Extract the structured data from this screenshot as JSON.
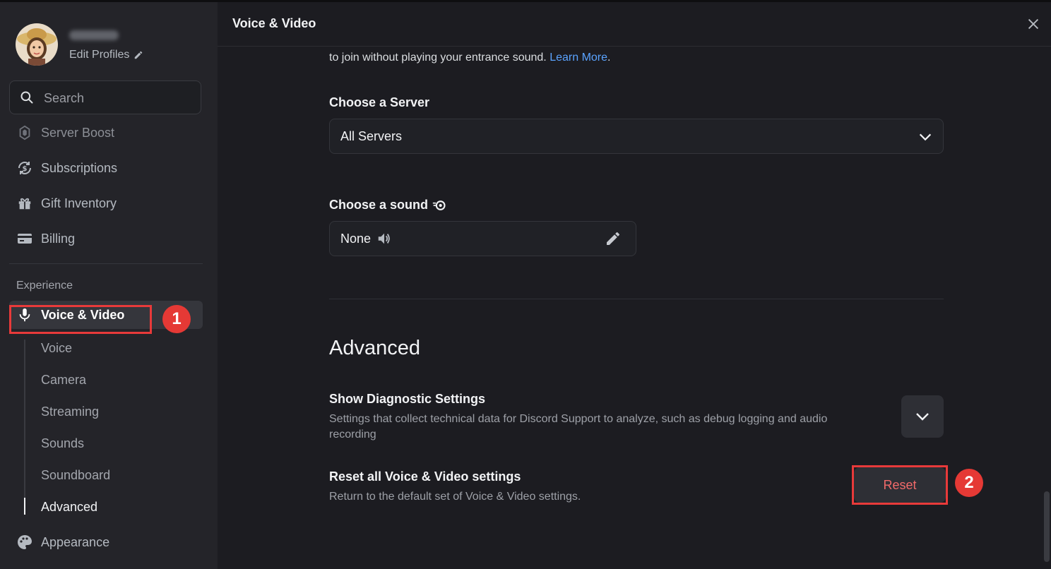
{
  "header": {
    "title": "Voice & Video"
  },
  "profile": {
    "edit_label": "Edit Profiles"
  },
  "search": {
    "placeholder": "Search"
  },
  "sidebar": {
    "items": [
      {
        "label": "Server Boost",
        "icon": "boost-icon"
      },
      {
        "label": "Subscriptions",
        "icon": "subscriptions-icon"
      },
      {
        "label": "Gift Inventory",
        "icon": "gift-icon"
      },
      {
        "label": "Billing",
        "icon": "billing-icon"
      }
    ],
    "section_label": "Experience",
    "active_item": {
      "label": "Voice & Video",
      "icon": "microphone-icon"
    },
    "sub_items": [
      "Voice",
      "Camera",
      "Streaming",
      "Sounds",
      "Soundboard",
      "Advanced"
    ],
    "last_item": {
      "label": "Appearance",
      "icon": "palette-icon"
    }
  },
  "main": {
    "intro_text": "to join without playing your entrance sound.",
    "learn_more": "Learn More",
    "intro_end": ".",
    "server_label": "Choose a Server",
    "server_value": "All Servers",
    "sound_label": "Choose a sound",
    "sound_value": "None",
    "advanced_title": "Advanced",
    "diagnostic_title": "Show Diagnostic Settings",
    "diagnostic_desc": "Settings that collect technical data for Discord Support to analyze, such as debug logging and audio recording",
    "reset_title": "Reset all Voice & Video settings",
    "reset_desc": "Return to the default set of Voice & Video settings.",
    "reset_label": "Reset"
  },
  "annotations": {
    "badge1": "1",
    "badge2": "2",
    "color": "#e83a3a"
  }
}
